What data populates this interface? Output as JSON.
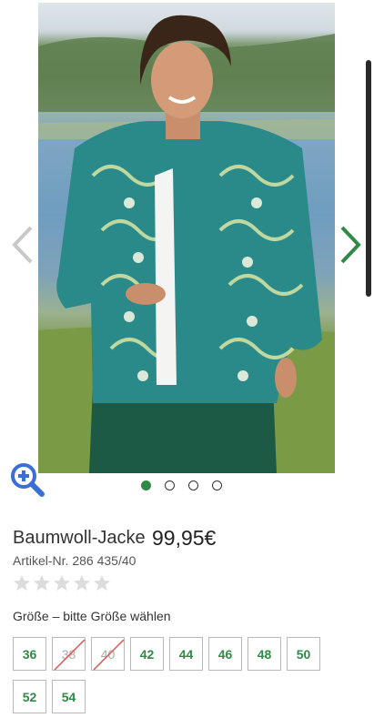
{
  "gallery": {
    "arrow_left_icon": "chevron-left-icon",
    "arrow_right_icon": "chevron-right-icon",
    "zoom_icon": "zoom-in-icon",
    "dots_count": 4,
    "active_dot": 1
  },
  "product": {
    "name": "Baumwoll-Jacke",
    "price": "99,95€",
    "article_number": "Artikel-Nr. 286 435/40",
    "rating": 0,
    "rating_max": 5
  },
  "size_selector": {
    "label": "Größe –  bitte Größe wählen",
    "sizes": [
      {
        "label": "36",
        "available": true
      },
      {
        "label": "38",
        "available": false
      },
      {
        "label": "40",
        "available": false
      },
      {
        "label": "42",
        "available": true
      },
      {
        "label": "44",
        "available": true
      },
      {
        "label": "46",
        "available": true
      },
      {
        "label": "48",
        "available": true
      },
      {
        "label": "50",
        "available": true
      },
      {
        "label": "52",
        "available": true
      },
      {
        "label": "54",
        "available": true
      }
    ]
  },
  "colors": {
    "accent": "#2e8a45",
    "zoom": "#3a6fd8",
    "arrow_left": "#c8c8c8",
    "arrow_right": "#2e8a45"
  }
}
